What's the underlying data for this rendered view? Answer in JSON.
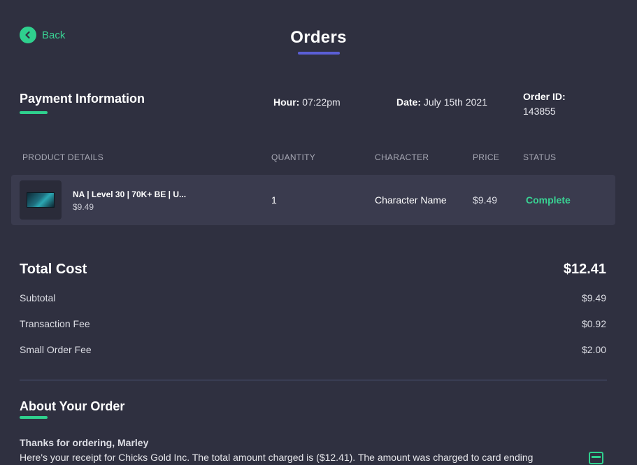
{
  "header": {
    "back_label": "Back",
    "title": "Orders"
  },
  "payment": {
    "heading": "Payment Information",
    "hour_label": "Hour:",
    "hour_value": "07:22pm",
    "date_label": "Date:",
    "date_value": "July 15th 2021",
    "order_id_label": "Order ID:",
    "order_id_value": "143855"
  },
  "table": {
    "columns": [
      "PRODUCT DETAILS",
      "QUANTITY",
      "CHARACTER",
      "PRICE",
      "STATUS"
    ],
    "rows": [
      {
        "product_name": "NA | Level 30 | 70K+ BE | U...",
        "product_price": "$9.49",
        "quantity": "1",
        "character": "Character Name",
        "price": "$9.49",
        "status": "Complete"
      }
    ]
  },
  "totals": {
    "total_label": "Total Cost",
    "total_value": "$12.41",
    "lines": [
      {
        "label": "Subtotal",
        "value": "$9.49"
      },
      {
        "label": "Transaction Fee",
        "value": "$0.92"
      },
      {
        "label": "Small Order Fee",
        "value": "$2.00"
      }
    ]
  },
  "about": {
    "heading": "About Your Order",
    "thanks": "Thanks for ordering, Marley",
    "receipt": "Here's your receipt for Chicks Gold Inc. The total amount charged is ($12.41). The amount was charged to card ending"
  },
  "icons": {
    "back": "chevron-left-icon",
    "card": "credit-card-icon"
  },
  "colors": {
    "background": "#2f3040",
    "accent_green": "#2fd08e",
    "accent_purple": "#5b5fd6",
    "row_background": "#3a3b4e"
  }
}
